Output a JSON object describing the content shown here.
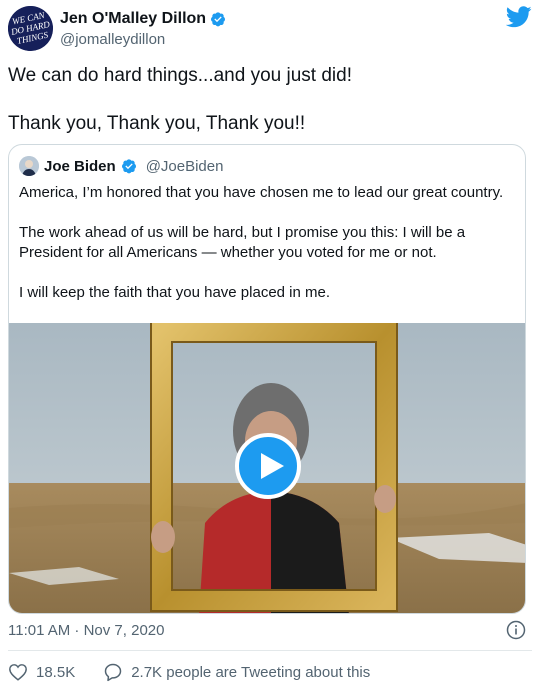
{
  "author": {
    "display_name": "Jen O'Malley Dillon",
    "handle": "@jomalleydillon",
    "avatar_text": "WE CAN DO HARD THINGS"
  },
  "tweet_text": "We can do hard things...and you just did!\n\nThank you, Thank you, Thank you!!",
  "quoted_tweet": {
    "display_name": "Joe Biden",
    "handle": "@JoeBiden",
    "text": "America, I’m honored that you have chosen me to lead our great country.\n\nThe work ahead of us will be hard, but I promise you this: I will be a President for all Americans — whether you voted for me or not.\n\nI will keep the faith that you have placed in me."
  },
  "timestamp": "11:01 AM · Nov 7, 2020",
  "actions": {
    "likes": "18.5K",
    "retweet_text": "2.7K people are Tweeting about this"
  },
  "icons": {
    "brand": "twitter-bird",
    "verified": "verified-badge",
    "info": "info-circle",
    "like": "heart-outline",
    "reply": "speech-bubble",
    "play": "play-triangle"
  },
  "colors": {
    "accent": "#1d9bf0",
    "text": "#0f1419",
    "muted": "#536471",
    "border": "#cfd9de"
  }
}
